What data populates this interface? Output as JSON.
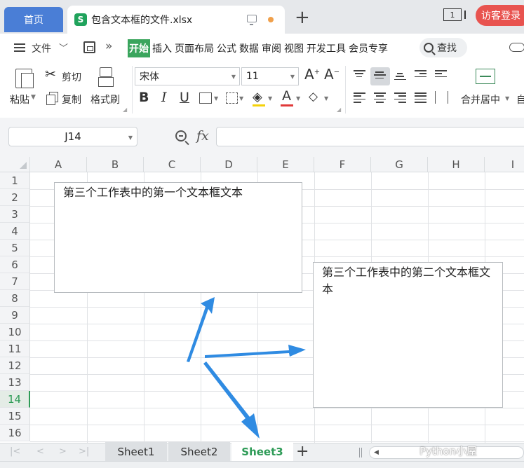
{
  "tabs": {
    "home": "首页",
    "file_title": "包含文本框的文件.xlsx",
    "window_count": "1",
    "guest_login": "访客登录"
  },
  "menu": {
    "file": "文件",
    "items": [
      "开始",
      "插入",
      "页面布局",
      "公式",
      "数据",
      "审阅",
      "视图",
      "开发工具",
      "会员专享"
    ],
    "active": "开始",
    "search": "查找"
  },
  "ribbon": {
    "paste": "粘贴",
    "cut": "剪切",
    "copy": "复制",
    "format_painter": "格式刷",
    "font_name": "宋体",
    "font_size": "11",
    "bold": "B",
    "italic": "I",
    "underline": "U",
    "font_color_letter": "A",
    "merge_center": "合并居中",
    "truncated_next": "自"
  },
  "formula_bar": {
    "cell_ref": "J14",
    "fx": "fx",
    "value": ""
  },
  "grid": {
    "columns": [
      "A",
      "B",
      "C",
      "D",
      "E",
      "F",
      "G",
      "H",
      "I"
    ],
    "rows": [
      "1",
      "2",
      "3",
      "4",
      "5",
      "6",
      "7",
      "8",
      "9",
      "10",
      "11",
      "12",
      "13",
      "14",
      "15",
      "16"
    ],
    "active_row": "14"
  },
  "textboxes": {
    "first": "第三个工作表中的第一个文本框文本",
    "second": "第三个工作表中的第二个文本框文本"
  },
  "sheets": {
    "tabs": [
      "Sheet1",
      "Sheet2",
      "Sheet3"
    ],
    "active": "Sheet3"
  },
  "watermark": "Python小屋",
  "colors": {
    "accent_green": "#2e9b57",
    "home_tab_blue": "#4a7ed6",
    "login_red": "#e8534f",
    "arrow_blue": "#2f8be2"
  }
}
